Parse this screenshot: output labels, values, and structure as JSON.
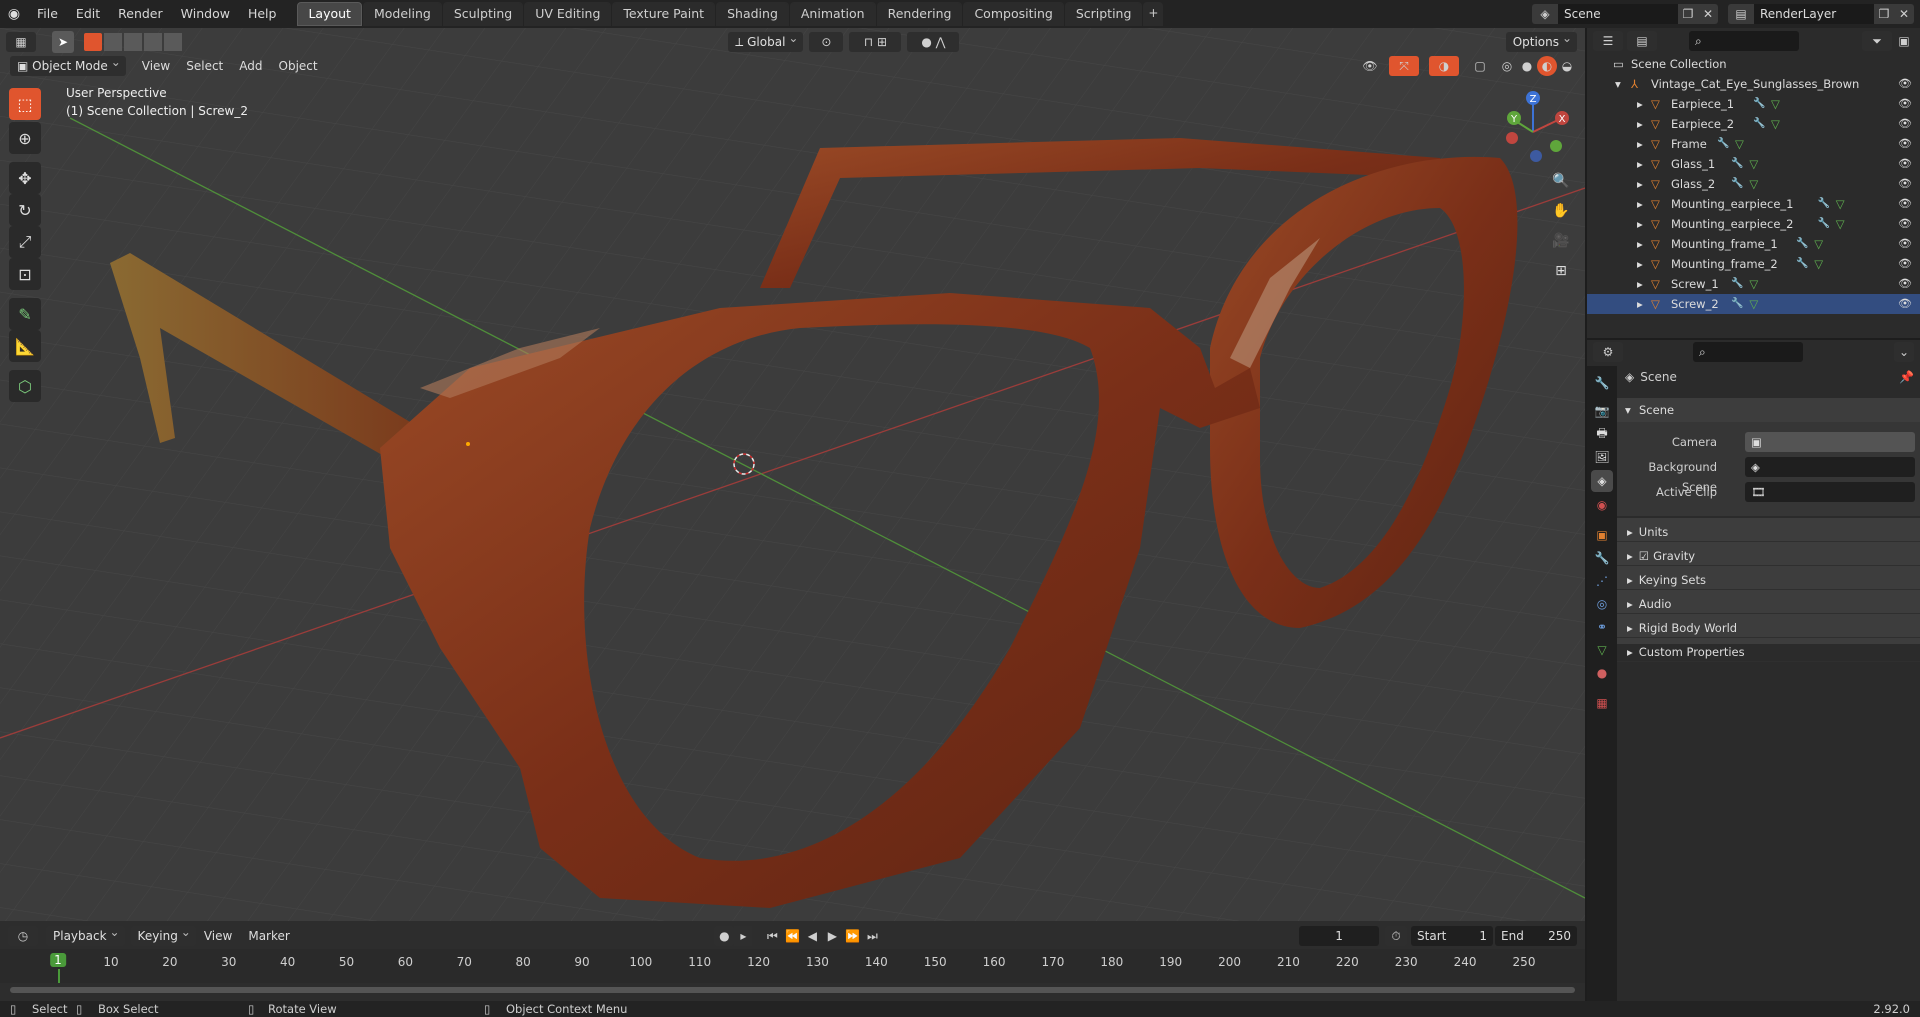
{
  "menus": [
    "File",
    "Edit",
    "Render",
    "Window",
    "Help"
  ],
  "workspaces": [
    "Layout",
    "Modeling",
    "Sculpting",
    "UV Editing",
    "Texture Paint",
    "Shading",
    "Animation",
    "Rendering",
    "Compositing",
    "Scripting"
  ],
  "active_workspace": "Layout",
  "add_tab_label": "+",
  "scene_field": "Scene",
  "renderlayer_field": "RenderLayer",
  "viewport": {
    "mode": "Object Mode",
    "menus": [
      "View",
      "Select",
      "Add",
      "Object"
    ],
    "transform_orientation": "Global",
    "options_label": "Options",
    "perspective_label": "User Perspective",
    "context_label": "(1) Scene Collection | Screw_2",
    "gizmo": {
      "x": "X",
      "y": "Y",
      "z": "Z"
    }
  },
  "timeline": {
    "playback": "Playback",
    "keying": "Keying",
    "view": "View",
    "marker": "Marker",
    "current_frame": "1",
    "start_label": "Start",
    "start": "1",
    "end_label": "End",
    "end": "250",
    "ticks": [
      "1",
      "10",
      "20",
      "30",
      "40",
      "50",
      "60",
      "70",
      "80",
      "90",
      "100",
      "110",
      "120",
      "130",
      "140",
      "150",
      "160",
      "170",
      "180",
      "190",
      "200",
      "210",
      "220",
      "230",
      "240",
      "250"
    ]
  },
  "outliner": {
    "root": "Scene Collection",
    "collection": "Vintage_Cat_Eye_Sunglasses_Brown",
    "objects": [
      "Earpiece_1",
      "Earpiece_2",
      "Frame",
      "Glass_1",
      "Glass_2",
      "Mounting_earpiece_1",
      "Mounting_earpiece_2",
      "Mounting_frame_1",
      "Mounting_frame_2",
      "Screw_1",
      "Screw_2"
    ],
    "selected": "Screw_2"
  },
  "properties": {
    "context": "Scene",
    "panel": "Scene",
    "camera_label": "Camera",
    "background_label": "Background Scene",
    "clip_label": "Active Clip",
    "subpanels": [
      "Units",
      "Gravity",
      "Keying Sets",
      "Audio",
      "Rigid Body World",
      "Custom Properties"
    ],
    "gravity_checked": true
  },
  "statusbar": {
    "select": "Select",
    "box_select": "Box Select",
    "rotate": "Rotate View",
    "context_menu": "Object Context Menu",
    "version": "2.92.0"
  },
  "colors": {
    "accent": "#e0552e",
    "selected": "#334d80",
    "frame_brown": "#7a2f18",
    "axis_x": "#c0463f",
    "axis_y": "#5fa63b",
    "axis_z": "#3d73d6"
  }
}
